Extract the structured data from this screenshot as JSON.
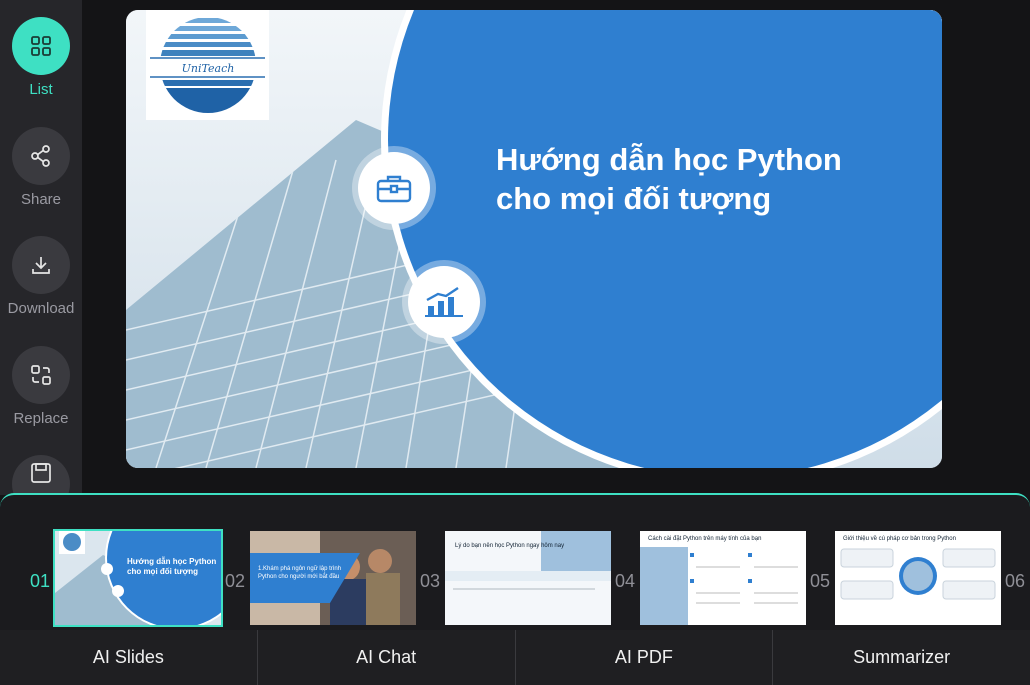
{
  "sidebar": {
    "items": [
      {
        "label": "List",
        "icon": "grid-icon",
        "active": true
      },
      {
        "label": "Share",
        "icon": "share-icon"
      },
      {
        "label": "Download",
        "icon": "download-icon"
      },
      {
        "label": "Replace",
        "icon": "replace-icon"
      },
      {
        "label": "",
        "icon": "save-icon"
      }
    ]
  },
  "slide": {
    "logo_text": "UniTeach",
    "title_line1": "Hướng dẫn học Python",
    "title_line2": "cho mọi đối tượng",
    "icons": [
      "briefcase-icon",
      "chart-icon"
    ]
  },
  "thumbnails": [
    {
      "num": "01",
      "title": "Hướng dẫn học Python cho mọi đối tượng",
      "active": true
    },
    {
      "num": "02",
      "title": "1.Khám phá ngôn ngữ lập trình Python cho người mới bắt đầu"
    },
    {
      "num": "03",
      "title": "Lý do bạn nên học Python ngay hôm nay"
    },
    {
      "num": "04",
      "title": "Cách cài đặt Python trên máy tính của bạn"
    },
    {
      "num": "05",
      "title": "Giới thiệu về cú pháp cơ bản trong Python"
    },
    {
      "num": "06",
      "title": ""
    }
  ],
  "bottom_nav": {
    "items": [
      "AI Slides",
      "AI Chat",
      "AI PDF",
      "Summarizer"
    ]
  },
  "colors": {
    "accent": "#3ee0c3",
    "slide_blue": "#2f7fd0",
    "sidebar_bg": "#26262a"
  }
}
